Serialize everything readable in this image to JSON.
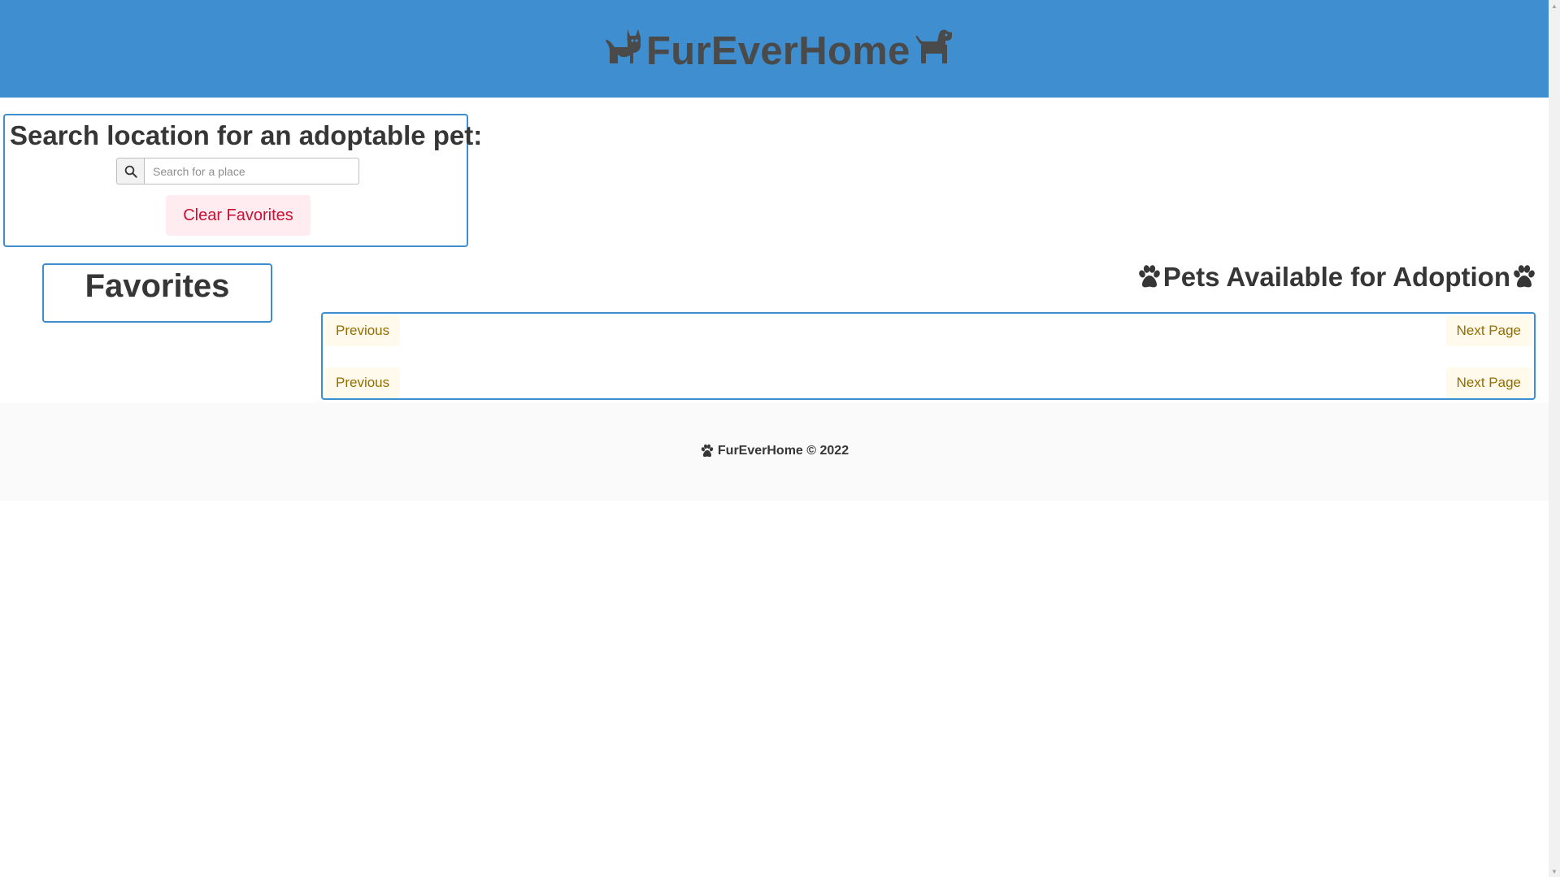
{
  "header": {
    "title": "FurEverHome",
    "left_icon": "cat-icon",
    "right_icon": "dog-icon",
    "background_color": "#3e8ed0"
  },
  "search": {
    "heading": "Search location for an adoptable pet:",
    "icon": "search-icon",
    "placeholder": "Search for a place",
    "value": "",
    "clear_favorites_label": "Clear Favorites"
  },
  "favorites": {
    "heading": "Favorites"
  },
  "pets": {
    "heading": "Pets Available for Adoption",
    "heading_icon": "paw-icon",
    "pagination_top": {
      "previous_label": "Previous",
      "next_label": "Next Page"
    },
    "pagination_bottom": {
      "previous_label": "Previous",
      "next_label": "Next Page"
    }
  },
  "footer": {
    "icon": "paw-icon",
    "text": "FurEverHome © 2022"
  }
}
